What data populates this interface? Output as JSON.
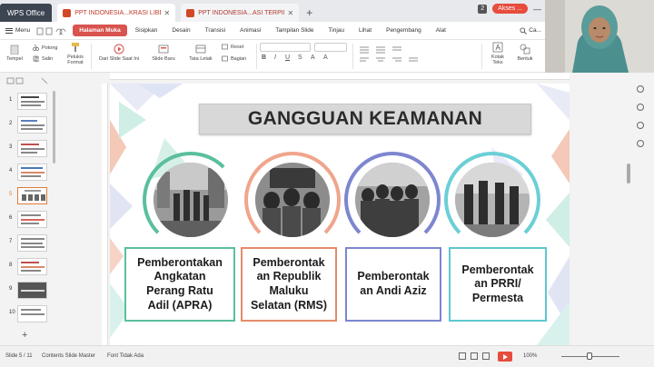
{
  "titlebar": {
    "app_name": "WPS Office",
    "tabs": [
      {
        "label": "PPT INDONESIA...KRASI LIBERAL",
        "active": true
      },
      {
        "label": "PPT INDONESIA...ASI TERPIMPIN",
        "active": false
      }
    ],
    "new_tab": "+",
    "window_badge": "2",
    "akses_label": "Akses ..."
  },
  "menubar": {
    "menu_label": "Menu",
    "tabs": [
      "Halaman Muka",
      "Sisipkan",
      "Desain",
      "Transisi",
      "Animasi",
      "Tampilan Slide",
      "Tinjau",
      "Lihat",
      "Pengembang",
      "Alat"
    ],
    "active_tab": "Halaman Muka",
    "search_label": "Ca..."
  },
  "ribbon": {
    "tempel": "Tempel",
    "potong": "Potong",
    "salin": "Salin",
    "pelukis_format": "Pelukis Format",
    "dari_slide": "Dari Slide Saat Ini",
    "slide_baru": "Slide Baru",
    "tata_letak": "Tata Letak",
    "reset": "Reset",
    "bagian": "Bagian",
    "kotak_teks": "Kotak Teks",
    "bentuk": "Bentuk"
  },
  "slide": {
    "title": "GANGGUAN KEAMANAN",
    "cards": [
      {
        "text": "Pemberontakan Angkatan Perang Ratu Adil (APRA)",
        "border": "#5bbf9c"
      },
      {
        "text": "Pemberontak an Republik Maluku Selatan (RMS)",
        "border": "#e58b6a"
      },
      {
        "text": "Pemberontak an Andi Aziz",
        "border": "#7d86cf"
      },
      {
        "text": "Pemberontak an PRRI/ Permesta",
        "border": "#5ec7cf"
      }
    ],
    "arc_colors": [
      "#5bbf9c",
      "#f0a58c",
      "#7d86cf",
      "#6bcfd6"
    ],
    "card_lines": [
      [
        "Pemberontakan",
        "Angkatan",
        "Perang Ratu",
        "Adil (APRA)"
      ],
      [
        "Pemberontak",
        "an Republik",
        "Maluku",
        "Selatan (RMS)"
      ],
      [
        "Pemberontak",
        "an Andi Aziz"
      ],
      [
        "Pemberontak",
        "an PRRI/",
        "Permesta"
      ]
    ]
  },
  "thumbnails": [
    "1",
    "2",
    "3",
    "4",
    "5",
    "6",
    "7",
    "8",
    "9",
    "10"
  ],
  "active_slide": "5",
  "statusbar": {
    "slide_info": "Slide 5 / 11",
    "master": "Contents Slide Master",
    "font_warning": "Font Tidak Ada",
    "zoom": "100%"
  },
  "colors": {
    "accent": "#d9534f",
    "app_dark": "#3d4553"
  }
}
